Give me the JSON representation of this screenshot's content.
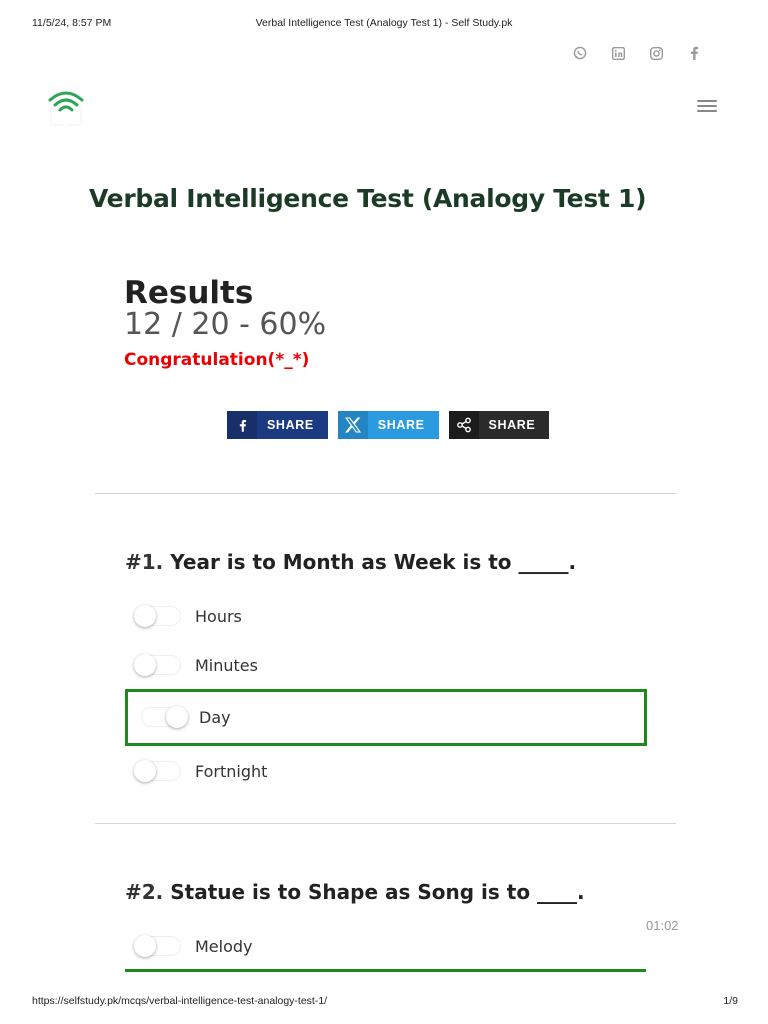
{
  "print_header": {
    "datetime": "11/5/24, 8:57 PM",
    "doc_title": "Verbal Intelligence Test (Analogy Test 1) - Self Study.pk"
  },
  "social_icons": [
    "whatsapp-icon",
    "linkedin-icon",
    "instagram-icon",
    "facebook-icon"
  ],
  "page_title": "Verbal Intelligence Test (Analogy Test 1)",
  "results": {
    "heading": "Results",
    "score": "12 / 20 - 60%",
    "message": "Congratulation(*_*)"
  },
  "share": [
    {
      "label": "SHARE",
      "icon": "facebook-icon"
    },
    {
      "label": "SHARE",
      "icon": "x-icon"
    },
    {
      "label": "SHARE",
      "icon": "share-icon"
    }
  ],
  "colors": {
    "correct": "#1e8a1e",
    "message": "#ee0000",
    "title": "#1b3b26",
    "logo": "#2aa655"
  },
  "questions": [
    {
      "number": "#1.",
      "text": "Year is to Month as Week is to _____.",
      "options": [
        {
          "label": "Hours",
          "selected": false
        },
        {
          "label": "Minutes",
          "selected": false
        },
        {
          "label": "Day",
          "selected": true,
          "correct": true
        },
        {
          "label": "Fortnight",
          "selected": false
        }
      ]
    },
    {
      "number": "#2.",
      "text": "Statue is to Shape as Song is to ____.",
      "options": [
        {
          "label": "Melody",
          "selected": false
        }
      ]
    }
  ],
  "timer": "01:02",
  "print_footer": {
    "url": "https://selfstudy.pk/mcqs/verbal-intelligence-test-analogy-test-1/",
    "page": "1/9"
  }
}
